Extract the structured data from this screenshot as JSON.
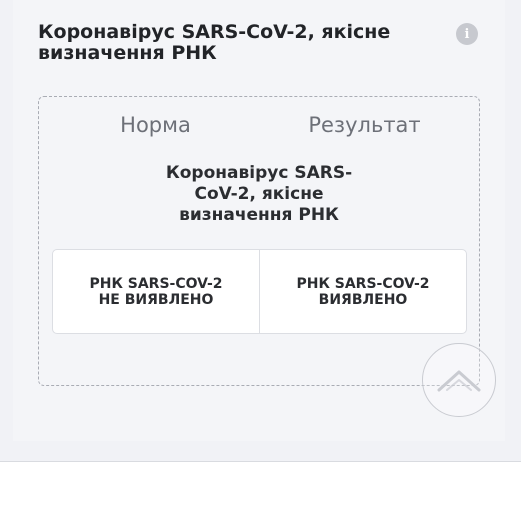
{
  "card": {
    "title": "Коронавірус SARS-CoV-2, якісне визначення РНК"
  },
  "table": {
    "norm_header": "Норма",
    "result_header": "Результат",
    "test_name": "Коронавірус SARS-CoV-2, якісне визначення РНК",
    "norm_value": "РНК SARS-COV-2 НЕ ВИЯВЛЕНО",
    "result_value": "РНК SARS-COV-2 ВИЯВЛЕНО"
  },
  "icons": {
    "info": "info-icon",
    "scroll_top": "chevron-up-icon"
  }
}
